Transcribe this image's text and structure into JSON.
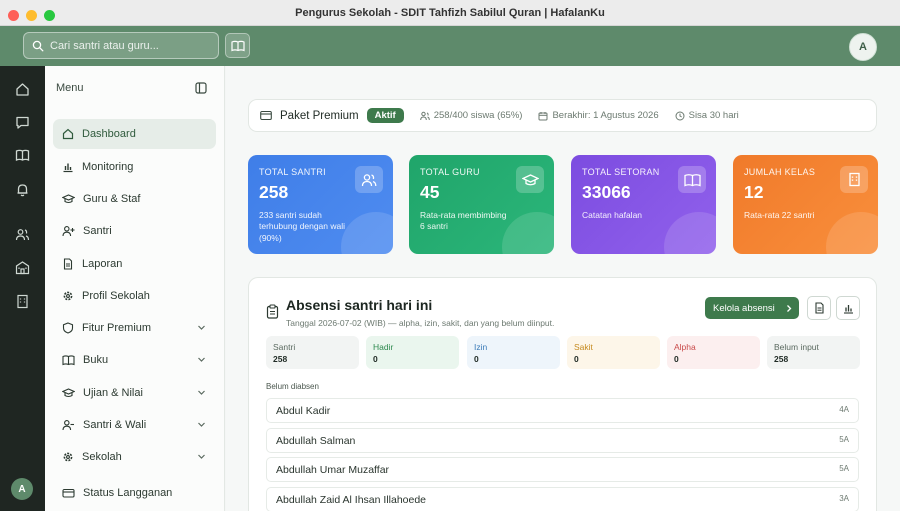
{
  "window": {
    "title": "Pengurus Sekolah - SDIT Tahfizh Sabilul Quran | HafalanKu"
  },
  "topbar": {
    "search_placeholder": "Cari santri atau guru...",
    "avatar_initial": "A"
  },
  "rail": {
    "avatar_initial": "A"
  },
  "sidebar": {
    "title": "Menu",
    "items": [
      {
        "label": "Dashboard",
        "icon": "home-icon"
      },
      {
        "label": "Monitoring",
        "icon": "chart-icon"
      },
      {
        "label": "Guru & Staf",
        "icon": "graduation-cap-icon"
      },
      {
        "label": "Santri",
        "icon": "user-plus-icon"
      },
      {
        "label": "Laporan",
        "icon": "document-icon"
      },
      {
        "label": "Profil Sekolah",
        "icon": "gear-icon"
      },
      {
        "label": "Fitur Premium",
        "icon": "shield-icon"
      },
      {
        "label": "Buku",
        "icon": "book-icon"
      },
      {
        "label": "Ujian & Nilai",
        "icon": "graduation-cap-icon"
      },
      {
        "label": "Santri & Wali",
        "icon": "users-icon"
      },
      {
        "label": "Sekolah",
        "icon": "gear-icon"
      },
      {
        "label": "Status Langganan",
        "icon": "card-icon"
      }
    ]
  },
  "plan": {
    "name": "Paket Premium",
    "badge": "Aktif",
    "students": "258/400 siswa (65%)",
    "expires": "Berakhir: 1 Agustus 2026",
    "remaining": "Sisa 30 hari"
  },
  "cards": [
    {
      "label": "TOTAL SANTRI",
      "value": "258",
      "sub": "233 santri sudah terhubung dengan wali (90%)"
    },
    {
      "label": "TOTAL GURU",
      "value": "45",
      "sub": "Rata-rata membimbing 6 santri"
    },
    {
      "label": "TOTAL SETORAN",
      "value": "33066",
      "sub": "Catatan hafalan"
    },
    {
      "label": "JUMLAH KELAS",
      "value": "12",
      "sub": "Rata-rata 22 santri"
    }
  ],
  "attendance": {
    "title": "Absensi santri hari ini",
    "subtitle": "Tanggal 2026-07-02 (WIB) — alpha, izin, sakit, dan yang belum diinput.",
    "manage_label": "Kelola absensi",
    "stats": [
      {
        "label": "Santri",
        "value": "258",
        "bg": "#f2f4f3",
        "color": "#5b6a60"
      },
      {
        "label": "Hadir",
        "value": "0",
        "bg": "#eaf6ee",
        "color": "#2e8a4f"
      },
      {
        "label": "Izin",
        "value": "0",
        "bg": "#eef5fb",
        "color": "#3b7bb8"
      },
      {
        "label": "Sakit",
        "value": "0",
        "bg": "#fdf6e9",
        "color": "#c58a1f"
      },
      {
        "label": "Alpha",
        "value": "0",
        "bg": "#fcefef",
        "color": "#c94a4a"
      },
      {
        "label": "Belum input",
        "value": "258",
        "bg": "#f2f4f3",
        "color": "#5b6a60"
      }
    ],
    "absent_label": "Belum diabsen",
    "absent": [
      {
        "name": "Abdul Kadir",
        "class": "4A"
      },
      {
        "name": "Abdullah Salman",
        "class": "5A"
      },
      {
        "name": "Abdullah Umar Muzaffar",
        "class": "5A"
      },
      {
        "name": "Abdullah Zaid Al Ihsan Illahoede",
        "class": "3A"
      }
    ]
  }
}
